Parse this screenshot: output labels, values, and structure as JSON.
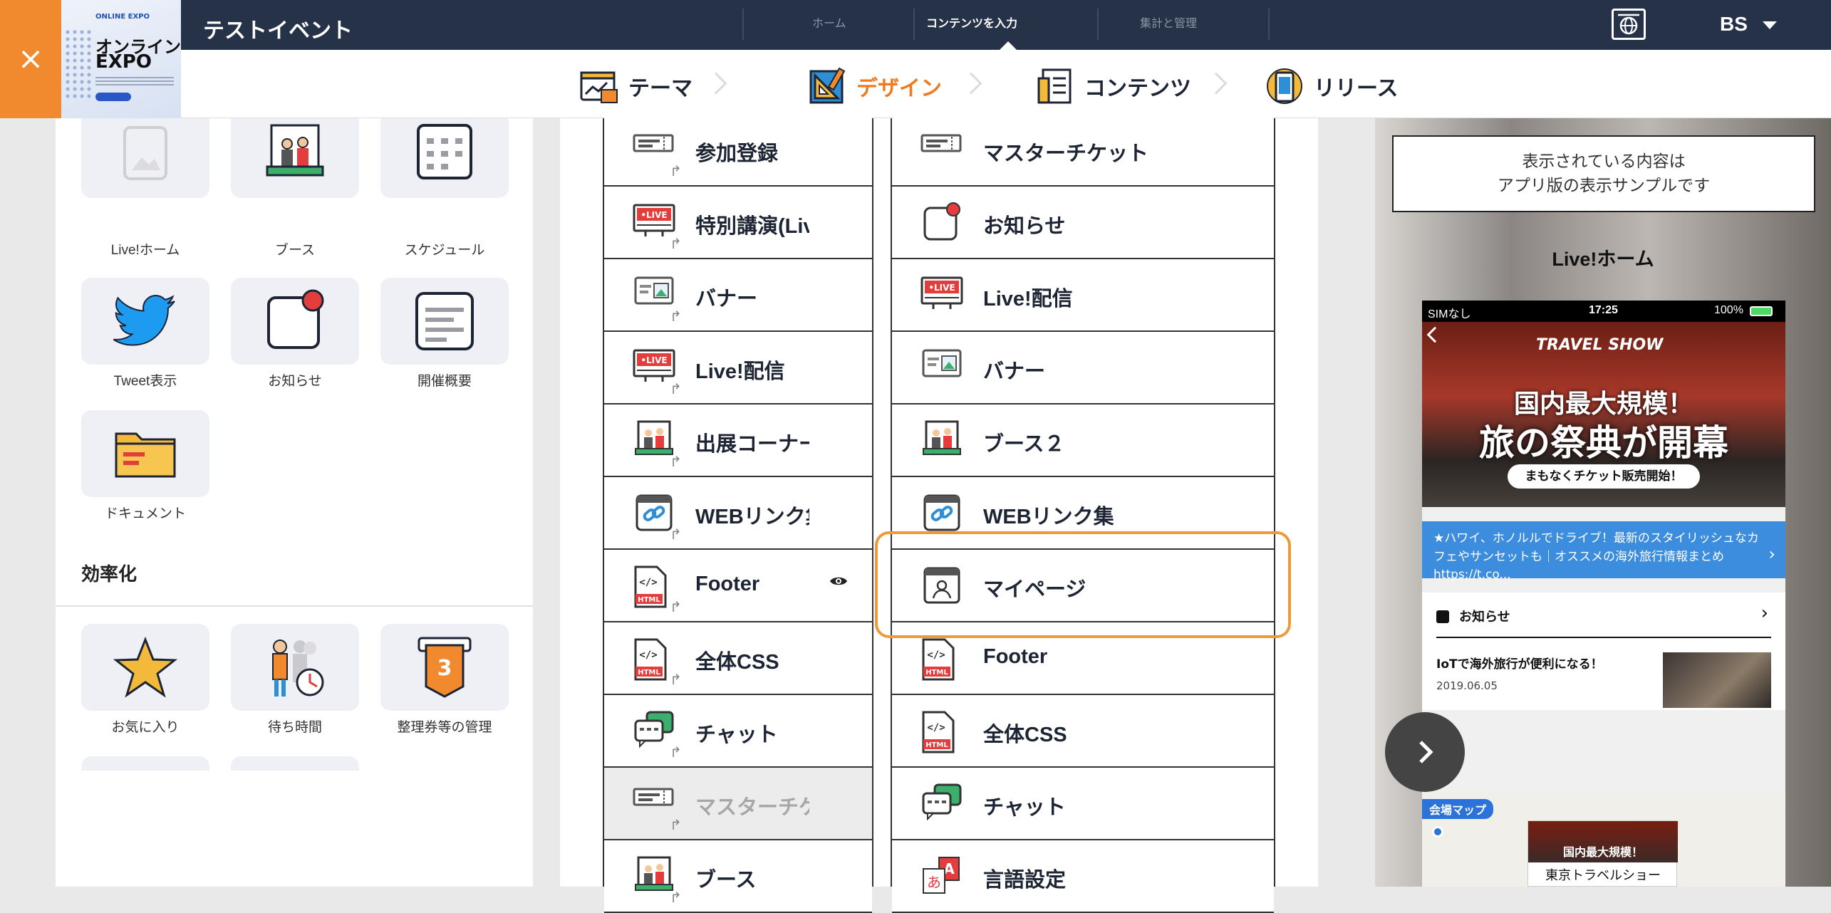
{
  "header": {
    "close_label": "×",
    "thumbnail": {
      "small": "ONLINE EXPO",
      "line1": "オンラインイ",
      "line2": "EXPO"
    },
    "event_title": "テストイベント",
    "nav": [
      {
        "label": "ホーム",
        "active": false
      },
      {
        "label": "コンテンツを入力",
        "active": true
      },
      {
        "label": "集計と管理",
        "active": false
      }
    ],
    "user_label": "BS"
  },
  "steps": [
    {
      "label": "テーマ",
      "active": false,
      "icon": "theme-icon"
    },
    {
      "label": "デザイン",
      "active": true,
      "icon": "design-icon"
    },
    {
      "label": "コンテンツ",
      "active": false,
      "icon": "contents-icon"
    },
    {
      "label": "リリース",
      "active": false,
      "icon": "release-icon"
    }
  ],
  "palette": {
    "tiles": [
      {
        "label": "Live!ホーム",
        "icon": "live-home-icon"
      },
      {
        "label": "ブース",
        "icon": "booth-icon"
      },
      {
        "label": "スケジュール",
        "icon": "calendar-icon"
      },
      {
        "label": "Tweet表示",
        "icon": "twitter-icon"
      },
      {
        "label": "お知らせ",
        "icon": "notification-icon"
      },
      {
        "label": "開催概要",
        "icon": "overview-icon"
      },
      {
        "label": "ドキュメント",
        "icon": "folder-icon"
      }
    ],
    "section_title": "効率化",
    "efficiency_tiles": [
      {
        "label": "お気に入り",
        "icon": "star-icon"
      },
      {
        "label": "待ち時間",
        "icon": "wait-time-icon"
      },
      {
        "label": "整理券等の管理",
        "icon": "ticket-number-icon"
      }
    ]
  },
  "column_a": [
    {
      "label": "参加登録",
      "icon": "ticket-icon",
      "dim": false
    },
    {
      "label": "特別講演(Live",
      "icon": "live-icon",
      "dim": false
    },
    {
      "label": "バナー",
      "icon": "banner-icon",
      "dim": false
    },
    {
      "label": "Live!配信",
      "icon": "live-icon",
      "dim": false
    },
    {
      "label": "出展コーナー",
      "icon": "booth-icon",
      "dim": false
    },
    {
      "label": "WEBリンク集",
      "icon": "link-icon",
      "dim": false
    },
    {
      "label": "Footer",
      "icon": "html-icon",
      "dim": false
    },
    {
      "label": "全体CSS",
      "icon": "html-icon",
      "dim": false
    },
    {
      "label": "チャット",
      "icon": "chat-icon",
      "dim": false
    },
    {
      "label": "マスターチケ",
      "icon": "ticket-icon",
      "dim": true
    },
    {
      "label": "ブース",
      "icon": "booth-icon",
      "dim": false
    }
  ],
  "column_b": [
    {
      "label": "マスターチケット",
      "icon": "ticket-icon"
    },
    {
      "label": "お知らせ",
      "icon": "notification-icon"
    },
    {
      "label": "Live!配信",
      "icon": "live-icon"
    },
    {
      "label": "バナー",
      "icon": "banner-icon"
    },
    {
      "label": "ブース２",
      "icon": "booth-icon"
    },
    {
      "label": "WEBリンク集",
      "icon": "link-icon"
    },
    {
      "label": "マイページ",
      "icon": "mypage-icon"
    },
    {
      "label": "Footer",
      "icon": "html-icon"
    },
    {
      "label": "全体CSS",
      "icon": "html-icon"
    },
    {
      "label": "チャット",
      "icon": "chat-icon"
    },
    {
      "label": "言語設定",
      "icon": "language-icon"
    }
  ],
  "preview": {
    "notice_line1": "表示されている内容は",
    "notice_line2": "アプリ版の表示サンプルです",
    "title": "Live!ホーム",
    "status": {
      "carrier": "SIMなし",
      "time": "17:25",
      "battery": "100%"
    },
    "hero": {
      "label": "TRAVEL SHOW",
      "line1": "国内最大規模！",
      "line2": "旅の祭典が開幕",
      "line3": "まもなくチケット販売開始！"
    },
    "banner_text": "★ハワイ、ホノルルでドライブ！最新のスタイリッシュなカフェやサンセットも｜オススメの海外旅行情報まとめ https://t.co...",
    "news_header": "お知らせ",
    "news_item": "IoTで海外旅行が便利になる！",
    "news_date": "2019.06.05",
    "map_tag": "会場マップ",
    "map_card_banner": "国内最大規模！",
    "map_card_title": "東京トラベルショー"
  },
  "colors": {
    "accent": "#ee7a22",
    "header_bg": "#253247",
    "highlight": "#ef9a39",
    "close_bg": "#f18a2f"
  }
}
